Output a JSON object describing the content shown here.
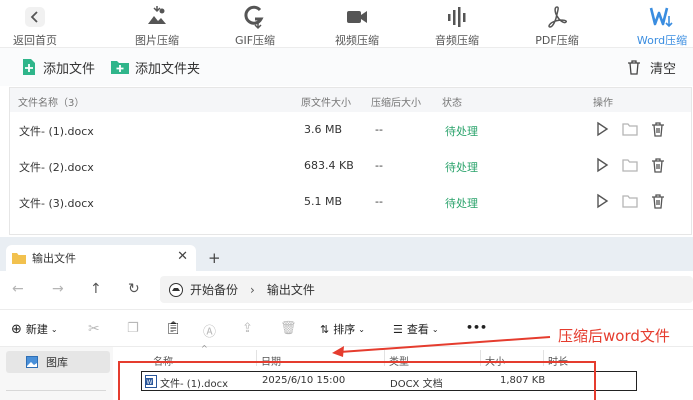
{
  "toolbar": {
    "back_label": "返回首页",
    "tools": [
      {
        "label": "图片压缩",
        "icon": "image-compress-icon"
      },
      {
        "label": "GIF压缩",
        "icon": "gif-compress-icon"
      },
      {
        "label": "视频压缩",
        "icon": "video-compress-icon"
      },
      {
        "label": "音频压缩",
        "icon": "audio-compress-icon"
      },
      {
        "label": "PDF压缩",
        "icon": "pdf-compress-icon"
      },
      {
        "label": "Word压缩",
        "icon": "word-compress-icon",
        "active": true
      }
    ]
  },
  "actions": {
    "add_file": "添加文件",
    "add_folder": "添加文件夹",
    "clear": "清空"
  },
  "file_table": {
    "headers": {
      "name": "文件名称（3）",
      "original_size": "原文件大小",
      "compressed_size": "压缩后大小",
      "status": "状态",
      "ops": "操作"
    },
    "rows": [
      {
        "name": "文件- (1).docx",
        "original_size": "3.6 MB",
        "compressed_size": "--",
        "status": "待处理"
      },
      {
        "name": "文件- (2).docx",
        "original_size": "683.4 KB",
        "compressed_size": "--",
        "status": "待处理"
      },
      {
        "name": "文件- (3).docx",
        "original_size": "5.1 MB",
        "compressed_size": "--",
        "status": "待处理"
      }
    ]
  },
  "explorer": {
    "tab_title": "输出文件",
    "tab_close": "✕",
    "new_tab": "+",
    "breadcrumb": [
      "开始备份",
      "输出文件"
    ],
    "commands": {
      "new": "新建",
      "sort": "排序",
      "view": "查看",
      "more": "•••"
    },
    "nav": {
      "gallery": "图库"
    },
    "columns": {
      "name": "名称",
      "date": "日期",
      "type": "类型",
      "size": "大小",
      "duration": "时长"
    },
    "rows": [
      {
        "name": "文件- (1).docx",
        "date": "2025/6/10 15:00",
        "type": "DOCX 文档",
        "size": "1,807 KB"
      }
    ]
  },
  "annotation": {
    "text": "压缩后word文件",
    "color": "#e53c2e"
  },
  "colors": {
    "accent": "#3a8de0",
    "status_pending": "#2aa36b",
    "add_icon": "#2fb58a"
  }
}
